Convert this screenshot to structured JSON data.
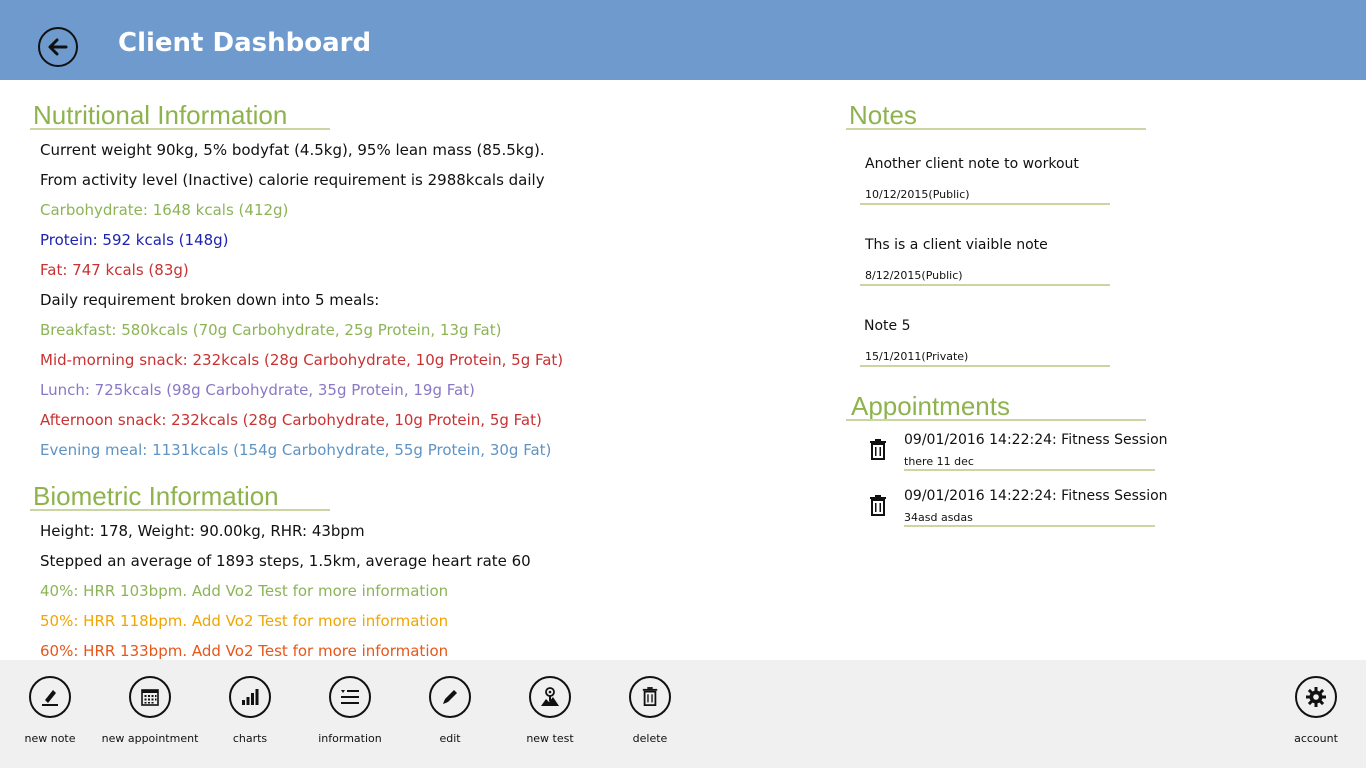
{
  "header": {
    "title": "Client Dashboard"
  },
  "nutrition": {
    "title": "Nutritional Information",
    "lines": [
      {
        "text": "Current weight 90kg, 5% bodyfat (4.5kg), 95% lean mass (85.5kg).",
        "color": "#111111"
      },
      {
        "text": "From activity level (Inactive) calorie requirement is 2988kcals daily",
        "color": "#111111"
      },
      {
        "text": "Carbohydrate: 1648 kcals (412g)",
        "color": "#8cb457"
      },
      {
        "text": "Protein: 592 kcals (148g)",
        "color": "#1f23b0"
      },
      {
        "text": "Fat: 747 kcals (83g)",
        "color": "#c83232"
      },
      {
        "text": "Daily requirement broken down into 5 meals:",
        "color": "#111111"
      },
      {
        "text": "Breakfast: 580kcals (70g Carbohydrate, 25g Protein, 13g Fat)",
        "color": "#8cb457"
      },
      {
        "text": "Mid-morning snack: 232kcals (28g Carbohydrate, 10g Protein, 5g Fat)",
        "color": "#c83232"
      },
      {
        "text": "Lunch: 725kcals (98g Carbohydrate, 35g Protein, 19g Fat)",
        "color": "#8a78c6"
      },
      {
        "text": "Afternoon snack: 232kcals (28g Carbohydrate, 10g Protein, 5g Fat)",
        "color": "#c83232"
      },
      {
        "text": "Evening meal: 1131kcals (154g Carbohydrate, 55g Protein, 30g Fat)",
        "color": "#5f93c3"
      }
    ]
  },
  "biometric": {
    "title": "Biometric Information",
    "lines": [
      {
        "text": "Height: 178, Weight: 90.00kg, RHR: 43bpm",
        "color": "#111111"
      },
      {
        "text": "Stepped an average of 1893 steps, 1.5km, average heart rate 60",
        "color": "#111111"
      },
      {
        "text": "40%: HRR 103bpm. Add Vo2 Test for more information",
        "color": "#8cb457"
      },
      {
        "text": "50%: HRR 118bpm. Add Vo2 Test for more information",
        "color": "#f0a500"
      },
      {
        "text": "60%: HRR 133bpm. Add Vo2 Test for more information",
        "color": "#e8561a"
      }
    ]
  },
  "notes": {
    "title": "Notes",
    "items": [
      {
        "text": "Another client note to workout",
        "meta": "10/12/2015(Public)"
      },
      {
        "text": "Ths is a client viaible note",
        "meta": "8/12/2015(Public)"
      },
      {
        "text": "Note 5",
        "meta": "15/1/2011(Private)"
      }
    ]
  },
  "appointments": {
    "title": "Appointments",
    "items": [
      {
        "title": "09/01/2016 14:22:24: Fitness Session",
        "desc": "there 11 dec",
        "icon": "trash-icon"
      },
      {
        "title": "09/01/2016 14:22:24: Fitness Session",
        "desc": "34asd asdas",
        "icon": "trash-icon"
      }
    ]
  },
  "appbar": {
    "buttons": [
      {
        "label": "new note",
        "icon": "pencil-line-icon"
      },
      {
        "label": "new appointment",
        "icon": "calendar-icon"
      },
      {
        "label": "charts",
        "icon": "bar-chart-icon"
      },
      {
        "label": "information",
        "icon": "list-icon"
      },
      {
        "label": "edit",
        "icon": "edit-pencil-icon"
      },
      {
        "label": "new test",
        "icon": "map-pin-icon"
      },
      {
        "label": "delete",
        "icon": "trash-icon"
      },
      {
        "label": "account",
        "icon": "gear-icon"
      }
    ]
  }
}
